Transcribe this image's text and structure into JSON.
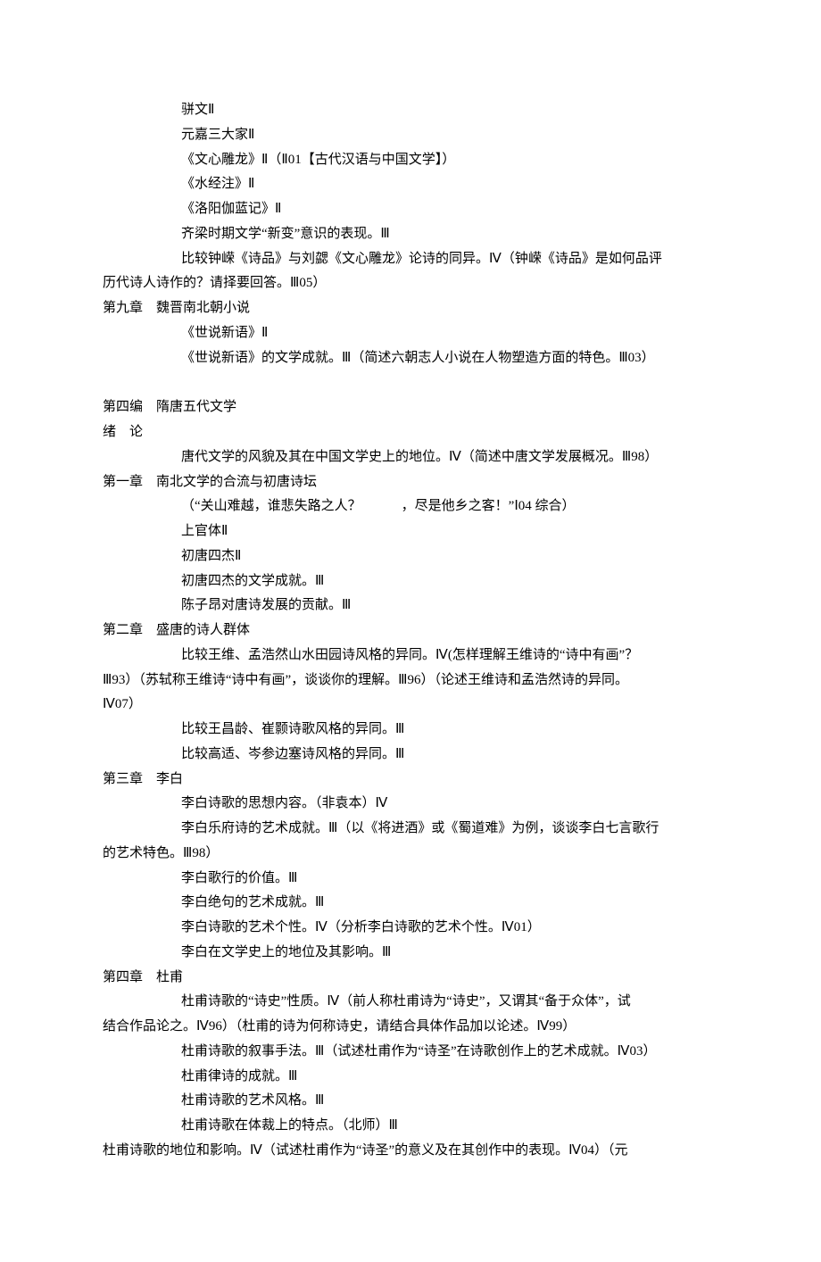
{
  "lines": [
    {
      "cls": "i2",
      "text": "骈文Ⅱ"
    },
    {
      "cls": "i2",
      "text": "元嘉三大家Ⅱ"
    },
    {
      "cls": "i2",
      "text": "《文心雕龙》Ⅱ（Ⅱ01【古代汉语与中国文学】）"
    },
    {
      "cls": "i2",
      "text": "《水经注》Ⅱ"
    },
    {
      "cls": "i2",
      "text": "《洛阳伽蓝记》Ⅱ"
    },
    {
      "cls": "i2",
      "text": "齐梁时期文学“新变”意识的表现。Ⅲ"
    },
    {
      "cls": "i2",
      "text": "比较钟嵘《诗品》与刘勰《文心雕龙》论诗的同异。Ⅳ（钟嵘《诗品》是如何品评"
    },
    {
      "cls": "i1",
      "text": "历代诗人诗作的？请择要回答。Ⅲ05）"
    },
    {
      "cls": "i1",
      "text": "第九章    魏晋南北朝小说"
    },
    {
      "cls": "i2",
      "text": "《世说新语》Ⅱ"
    },
    {
      "cls": "i2",
      "text": "《世说新语》的文学成就。Ⅲ（简述六朝志人小说在人物塑造方面的特色。Ⅲ03）"
    },
    {
      "cls": "spacer",
      "text": ""
    },
    {
      "cls": "i1",
      "text": "第四编    隋唐五代文学"
    },
    {
      "cls": "i1",
      "text": "绪    论"
    },
    {
      "cls": "i2",
      "text": "唐代文学的风貌及其在中国文学史上的地位。Ⅳ（简述中唐文学发展概况。Ⅲ98）"
    },
    {
      "cls": "i1",
      "text": "第一章    南北文学的合流与初唐诗坛"
    },
    {
      "cls": "i2",
      "text": "（“关山难越，谁悲失路之人？            ，尽是他乡之客！”Ⅰ04 综合）"
    },
    {
      "cls": "i2",
      "text": "上官体Ⅱ"
    },
    {
      "cls": "i2",
      "text": "初唐四杰Ⅱ"
    },
    {
      "cls": "i2",
      "text": "初唐四杰的文学成就。Ⅲ"
    },
    {
      "cls": "i2",
      "text": "陈子昂对唐诗发展的贡献。Ⅲ"
    },
    {
      "cls": "i1",
      "text": "第二章    盛唐的诗人群体"
    },
    {
      "cls": "i2",
      "text": "比较王维、孟浩然山水田园诗风格的异同。Ⅳ(怎样理解王维诗的“诗中有画”？"
    },
    {
      "cls": "i1",
      "text": "Ⅲ93）（苏轼称王维诗“诗中有画”，谈谈你的理解。Ⅲ96）（论述王维诗和孟浩然诗的异同。"
    },
    {
      "cls": "i1",
      "text": "Ⅳ07）"
    },
    {
      "cls": "i2",
      "text": "比较王昌龄、崔颢诗歌风格的异同。Ⅲ"
    },
    {
      "cls": "i2",
      "text": "比较高适、岑参边塞诗风格的异同。Ⅲ"
    },
    {
      "cls": "i1",
      "text": "第三章    李白"
    },
    {
      "cls": "i2",
      "text": "李白诗歌的思想内容。（非袁本）Ⅳ"
    },
    {
      "cls": "i2",
      "text": "李白乐府诗的艺术成就。Ⅲ（以《将进酒》或《蜀道难》为例，谈谈李白七言歌行"
    },
    {
      "cls": "i1",
      "text": "的艺术特色。Ⅲ98）"
    },
    {
      "cls": "i2",
      "text": "李白歌行的价值。Ⅲ"
    },
    {
      "cls": "i2",
      "text": "李白绝句的艺术成就。Ⅲ"
    },
    {
      "cls": "i2",
      "text": "李白诗歌的艺术个性。Ⅳ（分析李白诗歌的艺术个性。Ⅳ01）"
    },
    {
      "cls": "i2",
      "text": "李白在文学史上的地位及其影响。Ⅲ"
    },
    {
      "cls": "i1",
      "text": "第四章    杜甫"
    },
    {
      "cls": "i2",
      "text": "杜甫诗歌的“诗史”性质。Ⅳ（前人称杜甫诗为“诗史”，又谓其“备于众体”，试"
    },
    {
      "cls": "i1",
      "text": "结合作品论之。Ⅳ96）（杜甫的诗为何称诗史，请结合具体作品加以论述。Ⅳ99）"
    },
    {
      "cls": "i2",
      "text": "杜甫诗歌的叙事手法。Ⅲ（试述杜甫作为“诗圣”在诗歌创作上的艺术成就。Ⅳ03）"
    },
    {
      "cls": "i2",
      "text": "杜甫律诗的成就。Ⅲ"
    },
    {
      "cls": "i2",
      "text": "杜甫诗歌的艺术风格。Ⅲ"
    },
    {
      "cls": "i2",
      "text": "杜甫诗歌在体裁上的特点。（北师）Ⅲ"
    },
    {
      "cls": "i1",
      "text": "杜甫诗歌的地位和影响。Ⅳ（试述杜甫作为“诗圣”的意义及在其创作中的表现。Ⅳ04）（元"
    }
  ]
}
